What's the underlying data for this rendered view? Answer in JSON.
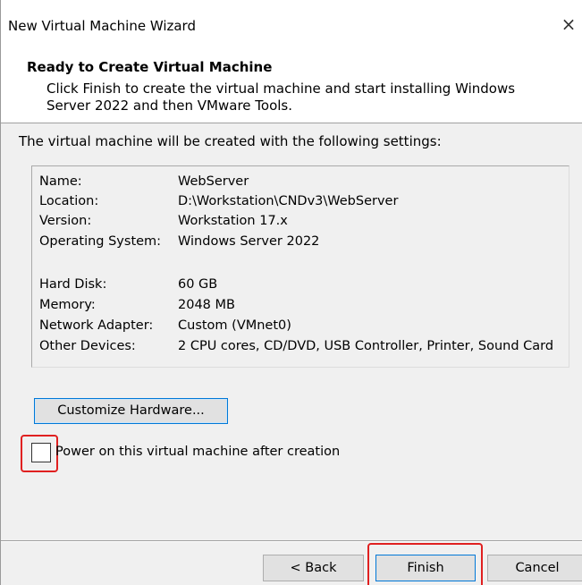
{
  "window": {
    "title": "New Virtual Machine Wizard",
    "close_glyph": "×"
  },
  "header": {
    "title": "Ready to Create Virtual Machine",
    "description": "Click Finish to create the virtual machine and start installing Windows Server 2022 and then VMware Tools."
  },
  "intro": "The virtual machine will be created with the following settings:",
  "settings": [
    {
      "key": "Name:",
      "value": "WebServer"
    },
    {
      "key": "Location:",
      "value": "D:\\Workstation\\CNDv3\\WebServer"
    },
    {
      "key": "Version:",
      "value": "Workstation 17.x"
    },
    {
      "key": "Operating System:",
      "value": "Windows Server 2022"
    },
    {
      "key": "Hard Disk:",
      "value": "60 GB"
    },
    {
      "key": "Memory:",
      "value": "2048 MB"
    },
    {
      "key": "Network Adapter:",
      "value": "Custom (VMnet0)"
    },
    {
      "key": "Other Devices:",
      "value": "2 CPU cores, CD/DVD, USB Controller, Printer, Sound Card"
    }
  ],
  "customize_button": "Customize Hardware...",
  "power_on": {
    "label": "Power on this virtual machine after creation",
    "checked": false
  },
  "buttons": {
    "back": "< Back",
    "finish": "Finish",
    "cancel": "Cancel"
  },
  "colors": {
    "highlight": "#e02020",
    "focus": "#0078d7"
  }
}
